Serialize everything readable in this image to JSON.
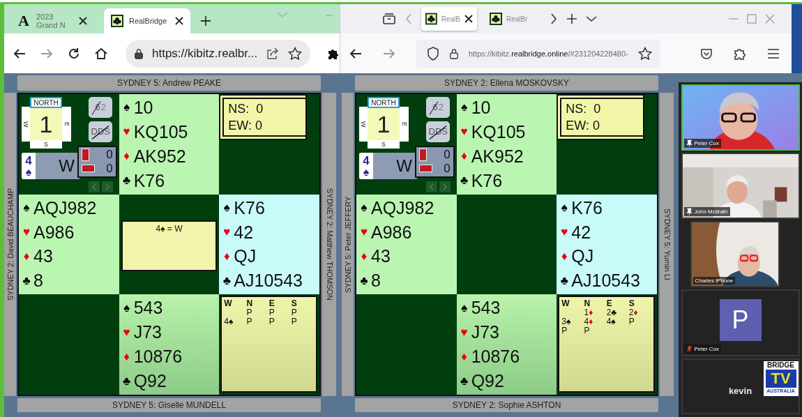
{
  "browsers": [
    {
      "kind": "edge",
      "tabs": [
        {
          "label": "2023 Grand N",
          "selected": false,
          "letter": "A"
        },
        {
          "label": "RealBridge",
          "selected": true
        }
      ],
      "url": [
        {
          "text": "https://kibitz.realbr...",
          "dim": false
        }
      ],
      "table": {
        "top_player": "SYDNEY 5: Andrew PEAKE",
        "left_player": "SYDNEY 2: David BEAUCHAMP",
        "right_player": "SYDNEY 2: Matthew THOMSON",
        "bottom_player": "SYDNEY 5: Giselle MUNDELL",
        "compass": {
          "north": "NORTH",
          "west": "W",
          "east": "E",
          "south": "S",
          "board": "1"
        },
        "buttons": [
          {
            "label": "6",
            "suffix": "2",
            "disabled": true
          },
          {
            "label": "DDS",
            "disabled": true
          }
        ],
        "contract": {
          "level": "4",
          "suit": "♠",
          "declarer": "W"
        },
        "tricks": [
          "0",
          "0"
        ],
        "score": [
          "NS:  0",
          "EW: 0"
        ],
        "hands": {
          "north": [
            {
              "suit": "♠",
              "cards": "10",
              "color": "#000000"
            },
            {
              "suit": "♥",
              "cards": "KQ105",
              "color": "#e8000b"
            },
            {
              "suit": "♦",
              "cards": "AK952",
              "color": "#e8000b"
            },
            {
              "suit": "♣",
              "cards": "K76",
              "color": "#000000"
            }
          ],
          "west": [
            {
              "suit": "♠",
              "cards": "AQJ982",
              "color": "#000000"
            },
            {
              "suit": "♥",
              "cards": "A986",
              "color": "#e8000b"
            },
            {
              "suit": "♦",
              "cards": "43",
              "color": "#e8000b"
            },
            {
              "suit": "♣",
              "cards": "8",
              "color": "#000000"
            }
          ],
          "east": [
            {
              "suit": "♠",
              "cards": "K76",
              "color": "#000000"
            },
            {
              "suit": "♥",
              "cards": "42",
              "color": "#e8000b"
            },
            {
              "suit": "♦",
              "cards": "QJ",
              "color": "#e8000b"
            },
            {
              "suit": "♣",
              "cards": "AJ10543",
              "color": "#000000"
            }
          ],
          "south": [
            {
              "suit": "♠",
              "cards": "543",
              "color": "#000000"
            },
            {
              "suit": "♥",
              "cards": "J73",
              "color": "#e8000b"
            },
            {
              "suit": "♦",
              "cards": "10876",
              "color": "#e8000b"
            },
            {
              "suit": "♣",
              "cards": "Q92",
              "color": "#000000"
            }
          ]
        },
        "result": "4♠ = W",
        "bidding": {
          "seats": [
            "W",
            "N",
            "E",
            "S"
          ],
          "rows": [
            [
              null,
              {
                "level": "P"
              },
              {
                "level": "P"
              },
              {
                "level": "P"
              }
            ],
            [
              {
                "level": "4",
                "suit": "♠",
                "color": "#000000"
              },
              {
                "level": "P"
              },
              {
                "level": "P"
              },
              {
                "level": "P"
              }
            ]
          ]
        }
      }
    },
    {
      "kind": "firefox",
      "tabs": [
        {
          "label": "RealB",
          "selected": true
        },
        {
          "label": "RealBr",
          "selected": false
        }
      ],
      "url": [
        {
          "text": "https://kibitz.",
          "dim": true
        },
        {
          "text": "realbridge.online",
          "dim": false
        },
        {
          "text": "/#231204228480-",
          "dim": true
        }
      ],
      "table": {
        "top_player": "SYDNEY 2: Ellena MOSKOVSKY",
        "left_player": "SYDNEY 5: Peter JEFFERY",
        "right_player": "SYDNEY 5: Yumin LI",
        "bottom_player": "SYDNEY 2: Sophie ASHTON",
        "compass": {
          "north": "NORTH",
          "west": "W",
          "east": "E",
          "south": "S",
          "board": "1"
        },
        "buttons": [
          {
            "label": "6",
            "suffix": "2",
            "disabled": true
          },
          {
            "label": "DDS",
            "disabled": true
          }
        ],
        "contract": {
          "level": "4",
          "suit": "♠",
          "declarer": "W"
        },
        "tricks": [
          "0",
          "0"
        ],
        "score": [
          "NS:  0",
          "EW: 0"
        ],
        "hands": {
          "north": [
            {
              "suit": "♠",
              "cards": "10",
              "color": "#000000"
            },
            {
              "suit": "♥",
              "cards": "KQ105",
              "color": "#e8000b"
            },
            {
              "suit": "♦",
              "cards": "AK952",
              "color": "#e8000b"
            },
            {
              "suit": "♣",
              "cards": "K76",
              "color": "#000000"
            }
          ],
          "west": [
            {
              "suit": "♠",
              "cards": "AQJ982",
              "color": "#000000"
            },
            {
              "suit": "♥",
              "cards": "A986",
              "color": "#e8000b"
            },
            {
              "suit": "♦",
              "cards": "43",
              "color": "#e8000b"
            },
            {
              "suit": "♣",
              "cards": "8",
              "color": "#000000"
            }
          ],
          "east": [
            {
              "suit": "♠",
              "cards": "K76",
              "color": "#000000"
            },
            {
              "suit": "♥",
              "cards": "42",
              "color": "#e8000b"
            },
            {
              "suit": "♦",
              "cards": "QJ",
              "color": "#e8000b"
            },
            {
              "suit": "♣",
              "cards": "AJ10543",
              "color": "#000000"
            }
          ],
          "south": [
            {
              "suit": "♠",
              "cards": "543",
              "color": "#000000"
            },
            {
              "suit": "♥",
              "cards": "J73",
              "color": "#e8000b"
            },
            {
              "suit": "♦",
              "cards": "10876",
              "color": "#e8000b"
            },
            {
              "suit": "♣",
              "cards": "Q92",
              "color": "#000000"
            }
          ]
        },
        "bidding": {
          "seats": [
            "W",
            "N",
            "E",
            "S"
          ],
          "rows": [
            [
              null,
              {
                "level": "1",
                "suit": "♦",
                "color": "#e8000b"
              },
              {
                "level": "2",
                "suit": "♣",
                "color": "#000000"
              },
              {
                "level": "2",
                "suit": "♦",
                "color": "#e8000b"
              }
            ],
            [
              {
                "level": "3",
                "suit": "♠",
                "color": "#000000"
              },
              {
                "level": "4",
                "suit": "♦",
                "color": "#e8000b"
              },
              {
                "level": "4",
                "suit": "♠",
                "color": "#000000"
              },
              {
                "level": "P"
              }
            ],
            [
              {
                "level": "P"
              },
              {
                "level": "P"
              },
              null,
              null
            ]
          ]
        }
      }
    }
  ],
  "video": {
    "tiles": [
      {
        "kind": "video",
        "name": "Peter Cox",
        "pinned": true,
        "muted": false,
        "speaking": true
      },
      {
        "kind": "video",
        "name": "John McIlrath",
        "pinned": true,
        "muted": false,
        "speaking": false
      },
      {
        "kind": "video",
        "name": "Charles iPhone",
        "pinned": false,
        "muted": false,
        "speaking": false
      },
      {
        "kind": "avatar",
        "initial": "P",
        "name": "Peter Cox",
        "pinned": false,
        "muted": true,
        "speaking": false
      },
      {
        "kind": "name_only",
        "name": "kevin",
        "speaking": false
      }
    ],
    "logo": {
      "top": "BRIDGE",
      "middle": "TV",
      "bottom": "AUSTRALIA"
    }
  }
}
